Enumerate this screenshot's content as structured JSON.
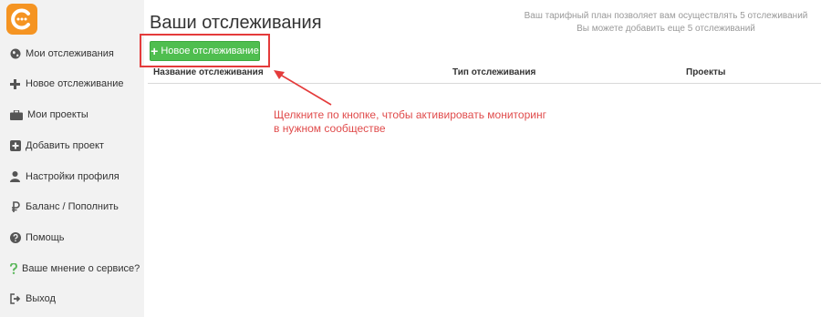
{
  "sidebar": {
    "items": [
      {
        "label": "Мои отслеживания",
        "icon": "globe-icon"
      },
      {
        "label": "Новое отслеживание",
        "icon": "plus-icon"
      },
      {
        "label": "Мои проекты",
        "icon": "briefcase-icon"
      },
      {
        "label": "Добавить проект",
        "icon": "plus-square-icon"
      },
      {
        "label": "Настройки профиля",
        "icon": "user-icon"
      },
      {
        "label": "Баланс / Пополнить",
        "icon": "ruble-icon"
      },
      {
        "label": "Помощь",
        "icon": "question-circle-icon"
      },
      {
        "label": "Ваше мнение о сервисе?",
        "icon": "question-icon"
      },
      {
        "label": "Выход",
        "icon": "sign-out-icon"
      }
    ]
  },
  "main": {
    "title": "Ваши отслеживания",
    "plan_info": [
      "Ваш тарифный план позволяет вам осуществлять 5 отслеживаний",
      "Вы можете добавить еще 5 отслеживаний"
    ],
    "new_button_label": "Новое отслеживание",
    "columns": [
      "Название отслеживания",
      "Тип отслеживания",
      "Проекты"
    ]
  },
  "annotation": {
    "lines": [
      "Щелкните по кнопке, чтобы активировать мониторинг",
      "в нужном сообществе"
    ]
  },
  "colors": {
    "brand": "#f59422",
    "button_green": "#4fbe4f",
    "annotation_red": "#e43b3b",
    "sidebar_bg": "#f2f2f2"
  }
}
